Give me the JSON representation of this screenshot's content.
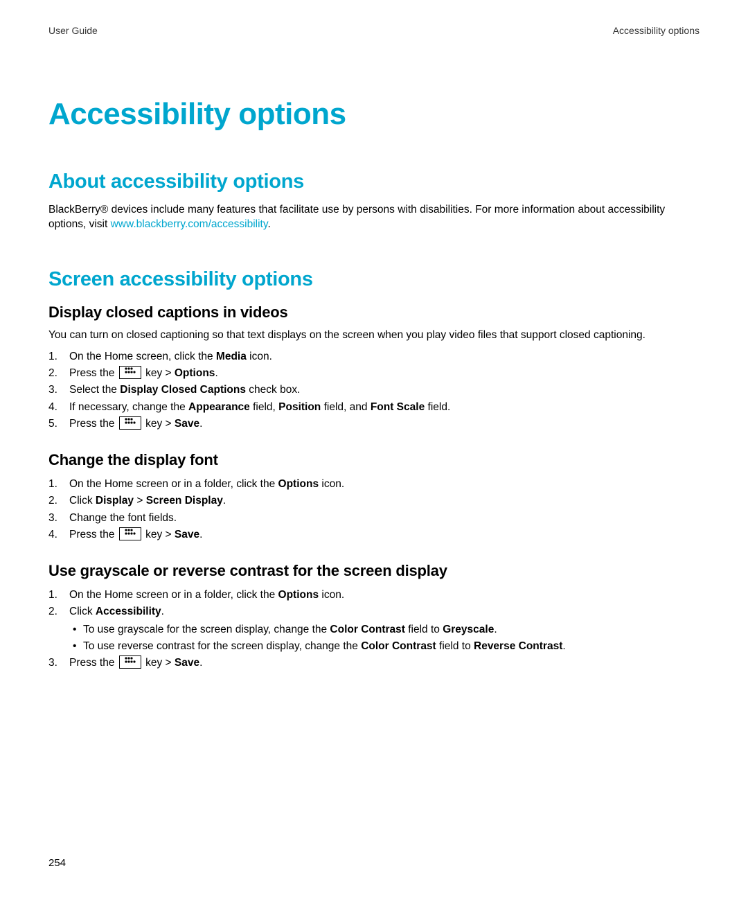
{
  "header": {
    "left": "User Guide",
    "right": "Accessibility options"
  },
  "title": "Accessibility options",
  "sectionAbout": {
    "heading": "About accessibility options",
    "text_a": "BlackBerry® devices include many features that facilitate use by persons with disabilities. For more information about accessibility options, visit ",
    "link": "www.blackberry.com/accessibility",
    "text_b": "."
  },
  "sectionScreen": {
    "heading": "Screen accessibility options",
    "captions": {
      "heading": "Display closed captions in videos",
      "intro": "You can turn on closed captioning so that text displays on the screen when you play video files that support closed captioning.",
      "steps": {
        "s1a": "On the Home screen, click the ",
        "s1b": "Media",
        "s1c": " icon.",
        "s2a": "Press the ",
        "s2b": " key > ",
        "s2c": "Options",
        "s2d": ".",
        "s3a": "Select the ",
        "s3b": "Display Closed Captions",
        "s3c": " check box.",
        "s4a": "If necessary, change the ",
        "s4b": "Appearance",
        "s4c": " field, ",
        "s4d": "Position",
        "s4e": " field, and ",
        "s4f": "Font Scale",
        "s4g": " field.",
        "s5a": "Press the ",
        "s5b": " key > ",
        "s5c": "Save",
        "s5d": "."
      }
    },
    "font": {
      "heading": "Change the display font",
      "steps": {
        "s1a": "On the Home screen or in a folder, click the ",
        "s1b": "Options",
        "s1c": " icon.",
        "s2a": "Click ",
        "s2b": "Display",
        "s2c": " > ",
        "s2d": "Screen Display",
        "s2e": ".",
        "s3": "Change the font fields.",
        "s4a": "Press the ",
        "s4b": " key > ",
        "s4c": "Save",
        "s4d": "."
      }
    },
    "contrast": {
      "heading": "Use grayscale or reverse contrast for the screen display",
      "steps": {
        "s1a": "On the Home screen or in a folder, click the ",
        "s1b": "Options",
        "s1c": " icon.",
        "s2a": "Click ",
        "s2b": "Accessibility",
        "s2c": ".",
        "sub1a": "To use grayscale for the screen display, change the ",
        "sub1b": "Color Contrast",
        "sub1c": " field to ",
        "sub1d": "Greyscale",
        "sub1e": ".",
        "sub2a": "To use reverse contrast for the screen display, change the ",
        "sub2b": "Color Contrast",
        "sub2c": " field to ",
        "sub2d": "Reverse Contrast",
        "sub2e": ".",
        "s3a": "Press the ",
        "s3b": " key > ",
        "s3c": "Save",
        "s3d": "."
      }
    }
  },
  "pageNumber": "254",
  "nums": {
    "n1": "1.",
    "n2": "2.",
    "n3": "3.",
    "n4": "4.",
    "n5": "5."
  }
}
